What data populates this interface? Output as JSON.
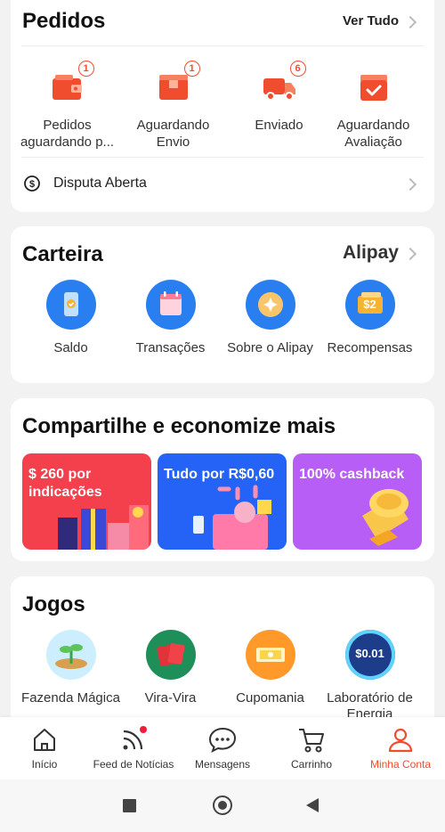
{
  "colors": {
    "accent": "#f04d2f",
    "background": "#f2f2f2",
    "wallet_blue": "#2a7ff0"
  },
  "orders": {
    "title": "Pedidos",
    "view_all": "Ver Tudo",
    "items": [
      {
        "label": "Pedidos aguardando p...",
        "badge": "1",
        "icon": "wallet-icon"
      },
      {
        "label": "Aguardando Envio",
        "badge": "1",
        "icon": "package-icon"
      },
      {
        "label": "Enviado",
        "badge": "6",
        "icon": "truck-icon"
      },
      {
        "label": "Aguardando Avaliação",
        "badge": "",
        "icon": "review-box-icon"
      }
    ],
    "dispute": "Disputa Aberta"
  },
  "wallet": {
    "title": "Carteira",
    "brand": "Alipay",
    "items": [
      {
        "label": "Saldo",
        "icon": "phone-balance-icon"
      },
      {
        "label": "Transações",
        "icon": "calendar-icon"
      },
      {
        "label": "Sobre o Alipay",
        "icon": "alipay-coin-icon"
      },
      {
        "label": "Recompensas",
        "icon": "reward-ticket-icon",
        "icon_text": "$2"
      }
    ]
  },
  "share": {
    "title": "Compartilhe e economize mais",
    "promos": [
      {
        "text": "$ 260 por indicações",
        "color": "#f43f4c"
      },
      {
        "text": "Tudo por R$0,60",
        "color": "#2463f5"
      },
      {
        "text": "100% cashback",
        "color": "#b65ef5"
      }
    ]
  },
  "games": {
    "title": "Jogos",
    "items": [
      {
        "label": "Fazenda Mágica",
        "icon": "farm-sprout-icon"
      },
      {
        "label": "Vira-Vira",
        "icon": "cards-icon"
      },
      {
        "label": "Cupomania",
        "icon": "coupon-icon"
      },
      {
        "label": "Laboratório de Energia",
        "icon": "energy-lab-icon",
        "icon_text": "$0.01"
      }
    ]
  },
  "tabbar": {
    "items": [
      {
        "label": "Início",
        "icon": "home-icon"
      },
      {
        "label": "Feed de Notícias",
        "icon": "feed-icon"
      },
      {
        "label": "Mensagens",
        "icon": "chat-icon"
      },
      {
        "label": "Carrinho",
        "icon": "cart-icon"
      },
      {
        "label": "Minha Conta",
        "icon": "account-icon",
        "active": true
      }
    ]
  },
  "system_nav": [
    "recent-apps-icon",
    "home-circle-icon",
    "back-triangle-icon"
  ]
}
